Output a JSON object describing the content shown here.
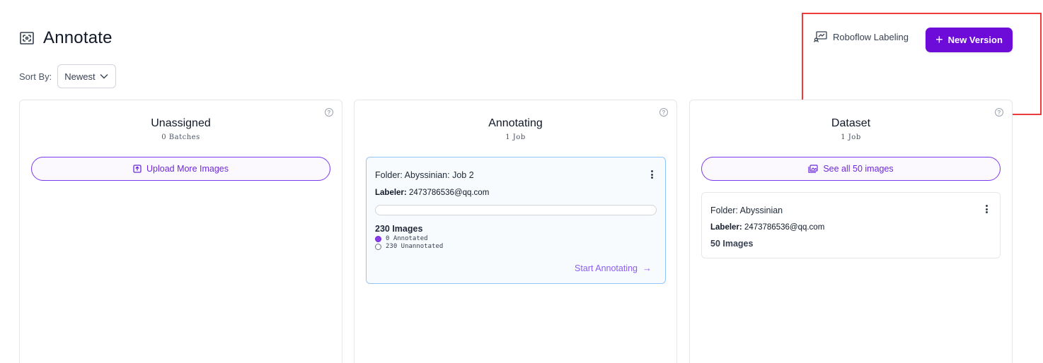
{
  "header": {
    "title": "Annotate",
    "title_icon": "annotate-frame-icon"
  },
  "sort": {
    "label": "Sort By:",
    "selected": "Newest"
  },
  "actions": {
    "labeling_label": "Roboflow Labeling",
    "new_version_label": "New Version"
  },
  "colors": {
    "accent": "#6d0cd8",
    "highlight": "#ef3b3b",
    "progress": "#8b3ce6"
  },
  "columns": [
    {
      "title": "Unassigned",
      "subtitle": "0 Batches",
      "help": "?",
      "button_label": "Upload More Images"
    },
    {
      "title": "Annotating",
      "subtitle": "1 Job",
      "help": "?",
      "job": {
        "folder": "Folder: Abyssinian: Job 2",
        "labeler_label": "Labeler:",
        "labeler_value": "2473786536@qq.com",
        "progress": 0,
        "image_count": "230 Images",
        "annotated": "0 Annotated",
        "unannotated": "230 Unannotated",
        "start_label": "Start Annotating"
      }
    },
    {
      "title": "Dataset",
      "subtitle": "1 Job",
      "help": "?",
      "button_label": "See all 50 images",
      "card": {
        "folder": "Folder: Abyssinian",
        "labeler_label": "Labeler:",
        "labeler_value": "2473786536@qq.com",
        "image_count": "50 Images"
      }
    }
  ]
}
